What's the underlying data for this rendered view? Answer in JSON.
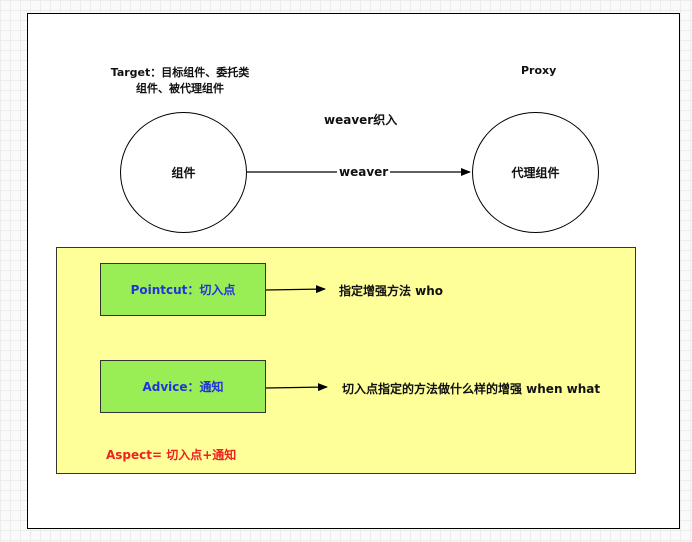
{
  "target": {
    "line1": "Target：目标组件、委托类",
    "line2": "组件、被代理组件"
  },
  "proxy_label": "Proxy",
  "weaving_title": "weaver织入",
  "component_label": "组件",
  "proxy_component_label": "代理组件",
  "weaver_arrow_label": "weaver",
  "pointcut": {
    "label": "Pointcut：切入点",
    "description": "指定增强方法 who"
  },
  "advice": {
    "label": "Advice：通知",
    "description": "切入点指定的方法做什么样的增强 when what"
  },
  "aspect_formula": "Aspect= 切入点+通知",
  "colors": {
    "aspect_fill": "#ffff99",
    "box_fill": "#99ee55",
    "box_text": "#2233dd",
    "formula_text": "#ee2222"
  }
}
